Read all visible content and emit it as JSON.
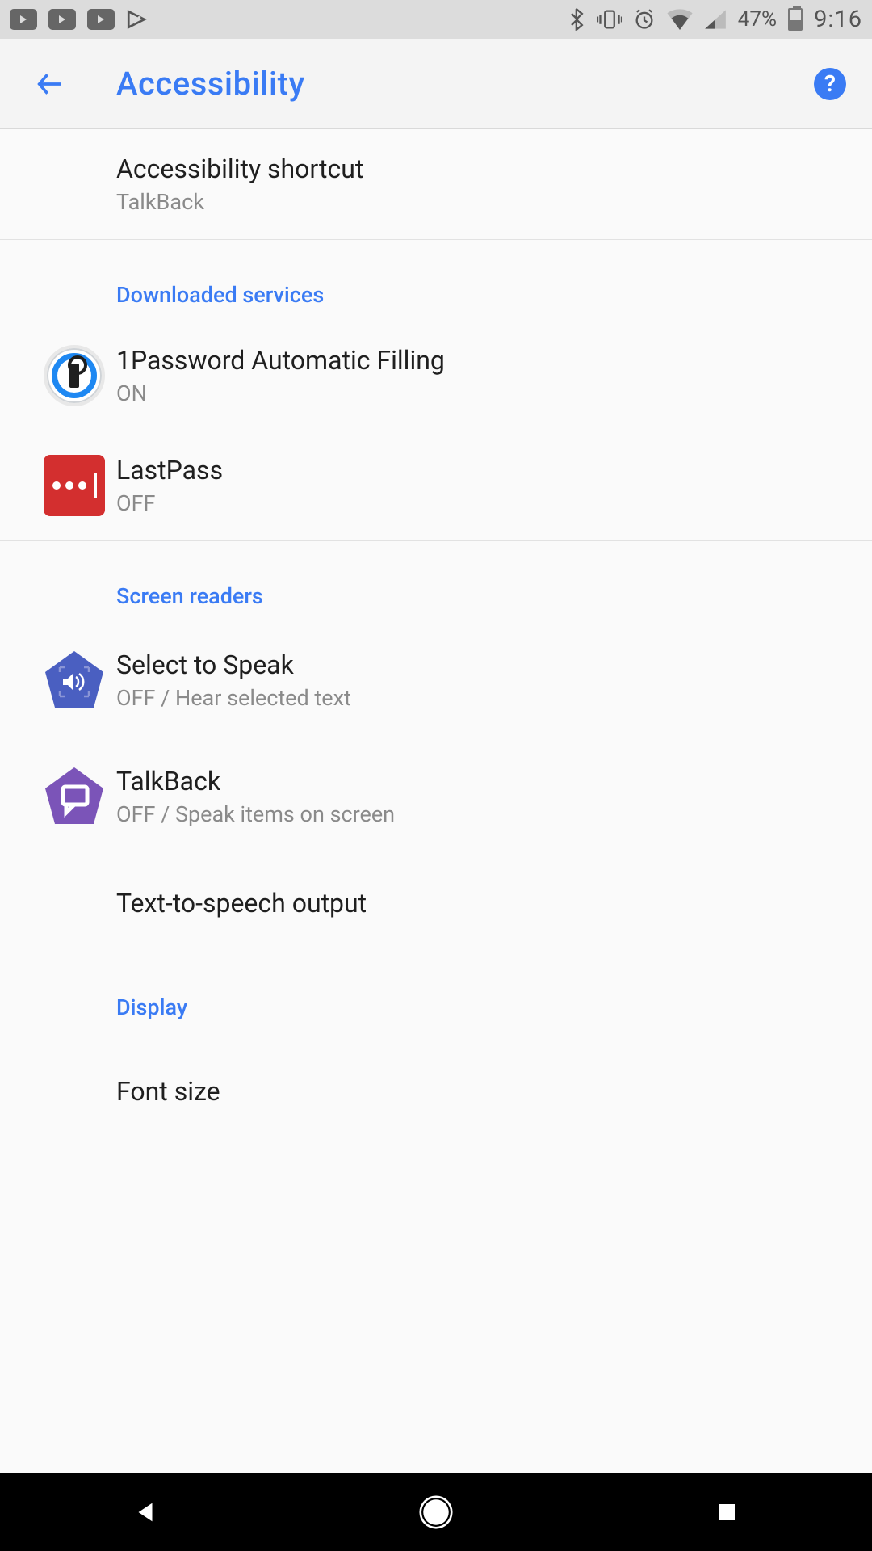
{
  "status": {
    "battery_pct": "47%",
    "time": "9:16"
  },
  "header": {
    "title": "Accessibility"
  },
  "shortcut": {
    "title": "Accessibility shortcut",
    "subtitle": "TalkBack"
  },
  "sections": {
    "downloaded": {
      "header": "Downloaded services",
      "items": [
        {
          "title": "1Password Automatic Filling",
          "subtitle": "ON"
        },
        {
          "title": "LastPass",
          "subtitle": "OFF"
        }
      ]
    },
    "screen_readers": {
      "header": "Screen readers",
      "items": [
        {
          "title": "Select to Speak",
          "subtitle": "OFF / Hear selected text"
        },
        {
          "title": "TalkBack",
          "subtitle": "OFF / Speak items on screen"
        },
        {
          "title": "Text-to-speech output"
        }
      ]
    },
    "display": {
      "header": "Display",
      "items": [
        {
          "title": "Font size"
        }
      ]
    }
  }
}
